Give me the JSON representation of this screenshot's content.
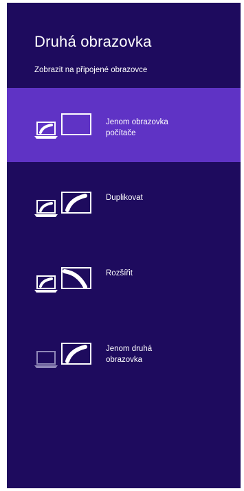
{
  "panel": {
    "title": "Druhá obrazovka",
    "subtitle": "Zobrazit na připojené obrazovce",
    "background": "#1e0b5e",
    "selected_background": "#5f33c5"
  },
  "options": [
    {
      "id": "pc-screen-only",
      "label_lines": [
        "Jenom obrazovka",
        "počítače"
      ],
      "selected": true
    },
    {
      "id": "duplicate",
      "label_lines": [
        "Duplikovat",
        ""
      ],
      "selected": false
    },
    {
      "id": "extend",
      "label_lines": [
        "Rozšířit",
        ""
      ],
      "selected": false
    },
    {
      "id": "second-screen-only",
      "label_lines": [
        "Jenom druhá",
        "obrazovka"
      ],
      "selected": false
    }
  ]
}
